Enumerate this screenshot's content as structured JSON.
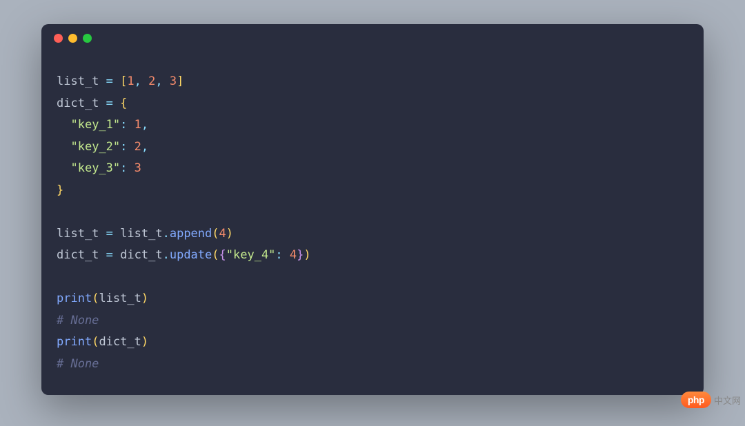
{
  "code": {
    "lines": [
      {
        "type": "assign",
        "tokens": [
          "list_t",
          " ",
          "=",
          " ",
          "[",
          "1",
          ",",
          " ",
          "2",
          ",",
          " ",
          "3",
          "]"
        ],
        "classes": [
          "tok-var",
          "",
          "tok-op",
          "",
          "tok-bracket-yellow",
          "tok-num",
          "tok-punc",
          "",
          "tok-num",
          "tok-punc",
          "",
          "tok-num",
          "tok-bracket-yellow"
        ]
      },
      {
        "type": "assign",
        "tokens": [
          "dict_t",
          " ",
          "=",
          " ",
          "{"
        ],
        "classes": [
          "tok-var",
          "",
          "tok-op",
          "",
          "tok-bracket-yellow"
        ]
      },
      {
        "type": "dictentry",
        "tokens": [
          "  ",
          "\"key_1\"",
          ":",
          " ",
          "1",
          ","
        ],
        "classes": [
          "",
          "tok-str",
          "tok-op",
          "",
          "tok-num",
          "tok-punc"
        ]
      },
      {
        "type": "dictentry",
        "tokens": [
          "  ",
          "\"key_2\"",
          ":",
          " ",
          "2",
          ","
        ],
        "classes": [
          "",
          "tok-str",
          "tok-op",
          "",
          "tok-num",
          "tok-punc"
        ]
      },
      {
        "type": "dictentry",
        "tokens": [
          "  ",
          "\"key_3\"",
          ":",
          " ",
          "3"
        ],
        "classes": [
          "",
          "tok-str",
          "tok-op",
          "",
          "tok-num"
        ]
      },
      {
        "type": "close",
        "tokens": [
          "}"
        ],
        "classes": [
          "tok-bracket-yellow"
        ]
      },
      {
        "type": "blank",
        "tokens": [
          " "
        ],
        "classes": [
          ""
        ]
      },
      {
        "type": "call",
        "tokens": [
          "list_t",
          " ",
          "=",
          " ",
          "list_t",
          ".",
          "append",
          "(",
          "4",
          ")"
        ],
        "classes": [
          "tok-var",
          "",
          "tok-op",
          "",
          "tok-var",
          "tok-punc",
          "tok-func",
          "tok-bracket-yellow",
          "tok-num",
          "tok-bracket-yellow"
        ]
      },
      {
        "type": "call",
        "tokens": [
          "dict_t",
          " ",
          "=",
          " ",
          "dict_t",
          ".",
          "update",
          "(",
          "{",
          "\"key_4\"",
          ":",
          " ",
          "4",
          "}",
          ")"
        ],
        "classes": [
          "tok-var",
          "",
          "tok-op",
          "",
          "tok-var",
          "tok-punc",
          "tok-func",
          "tok-bracket-yellow",
          "tok-bracket-purple",
          "tok-str",
          "tok-op",
          "",
          "tok-num",
          "tok-bracket-purple",
          "tok-bracket-yellow"
        ]
      },
      {
        "type": "blank",
        "tokens": [
          " "
        ],
        "classes": [
          ""
        ]
      },
      {
        "type": "print",
        "tokens": [
          "print",
          "(",
          "list_t",
          ")"
        ],
        "classes": [
          "tok-builtin",
          "tok-bracket-yellow",
          "tok-var",
          "tok-bracket-yellow"
        ]
      },
      {
        "type": "comment",
        "tokens": [
          "# None"
        ],
        "classes": [
          "tok-comment"
        ]
      },
      {
        "type": "print",
        "tokens": [
          "print",
          "(",
          "dict_t",
          ")"
        ],
        "classes": [
          "tok-builtin",
          "tok-bracket-yellow",
          "tok-var",
          "tok-bracket-yellow"
        ]
      },
      {
        "type": "comment",
        "tokens": [
          "# None"
        ],
        "classes": [
          "tok-comment"
        ]
      }
    ]
  },
  "badge": {
    "logo": "php",
    "text": "中文网"
  },
  "colors": {
    "background": "#aab2bd",
    "editor_bg": "#292d3e",
    "red": "#fe5f57",
    "yellow": "#febc2e",
    "green": "#27c840"
  }
}
